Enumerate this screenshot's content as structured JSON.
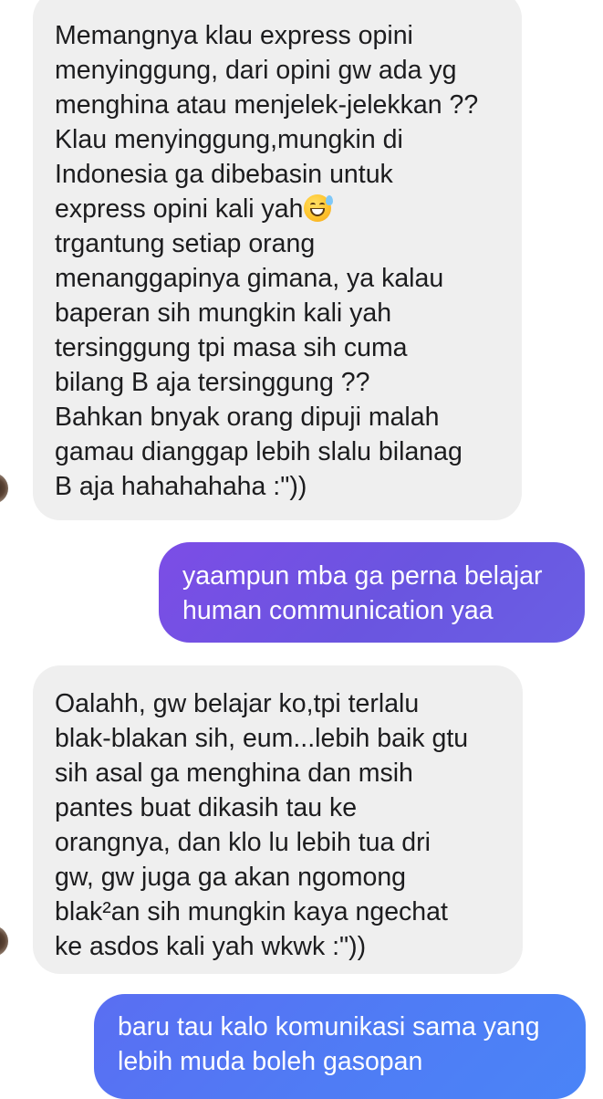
{
  "conversation": {
    "messages": [
      {
        "sender": "other",
        "lines": [
          "Memangnya klau express opini",
          "menyinggung, dari opini gw ada yg",
          "menghina atau menjelek-jelekkan ??",
          "Klau menyinggung,mungkin di",
          "Indonesia ga dibebasin untuk",
          "express opini kali yah",
          "trgantung setiap orang",
          "menanggapinya gimana, ya kalau",
          "baperan sih mungkin kali yah",
          "tersinggung tpi masa sih cuma",
          "bilang B aja tersinggung ??",
          "Bahkan bnyak orang dipuji malah",
          "gamau dianggap lebih slalu bilanag",
          "B aja hahahahaha :\"))"
        ],
        "emoji": "grinning-face-with-sweat"
      },
      {
        "sender": "me",
        "lines": [
          "yaampun mba ga perna belajar",
          "human communication yaa"
        ]
      },
      {
        "sender": "other",
        "lines": [
          "Oalahh, gw belajar ko,tpi terlalu",
          "blak-blakan sih, eum...lebih baik gtu",
          "sih asal ga menghina dan msih",
          "pantes buat dikasih tau ke",
          "orangnya, dan klo lu lebih tua dri",
          "gw, gw juga ga akan ngomong",
          "blak²an sih mungkin kaya ngechat",
          "ke asdos kali yah wkwk :\"))"
        ]
      },
      {
        "sender": "me",
        "lines": [
          "baru tau kalo komunikasi sama yang",
          "lebih muda boleh gasopan"
        ]
      }
    ]
  },
  "colors": {
    "incoming_bubble": "#efefef",
    "incoming_text": "#1c1c1e",
    "outgoing_bubble_purple": "#6a55e0",
    "outgoing_bubble_blue": "#4f7cf5",
    "outgoing_text": "#ffffff"
  }
}
